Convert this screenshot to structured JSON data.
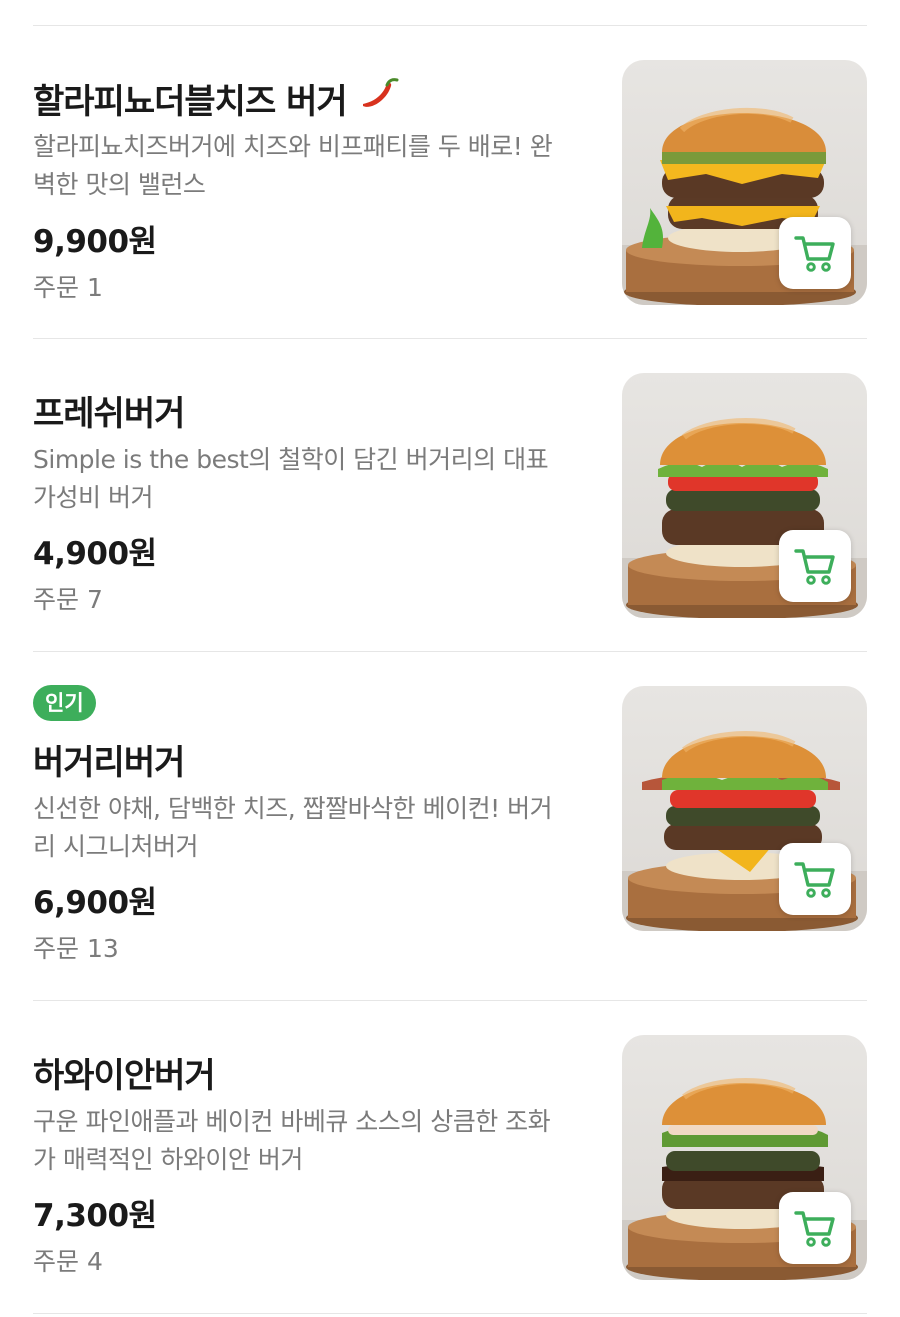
{
  "colors": {
    "accent": "#3dae5b",
    "muted": "#7b7b7b"
  },
  "menu": [
    {
      "badge": "",
      "name": "할라피뇨더블치즈 버거",
      "name_icon": "chili-pepper-icon",
      "desc_line1": "할라피뇨치즈버거에 치즈와 비프패티를 두 배로! 완",
      "desc_line2": "벽한 맛의 밸런스",
      "price": "9,900원",
      "orders": "주문 1"
    },
    {
      "badge": "",
      "name": "프레쉬버거",
      "desc_line1": "Simple is the best의 철학이 담긴 버거리의 대표",
      "desc_line2": "가성비 버거",
      "price": "4,900원",
      "orders": "주문 7"
    },
    {
      "badge": "인기",
      "name": "버거리버거",
      "desc_line1": "신선한 야채, 담백한 치즈, 짭짤바삭한 베이컨! 버거",
      "desc_line2": "리 시그니처버거",
      "price": "6,900원",
      "orders": "주문 13"
    },
    {
      "badge": "",
      "name": "하와이안버거",
      "desc_line1": "구운 파인애플과 베이컨 바베큐 소스의 상큼한 조화",
      "desc_line2": "가 매력적인 하와이안 버거",
      "price": "7,300원",
      "orders": "주문 4"
    }
  ]
}
